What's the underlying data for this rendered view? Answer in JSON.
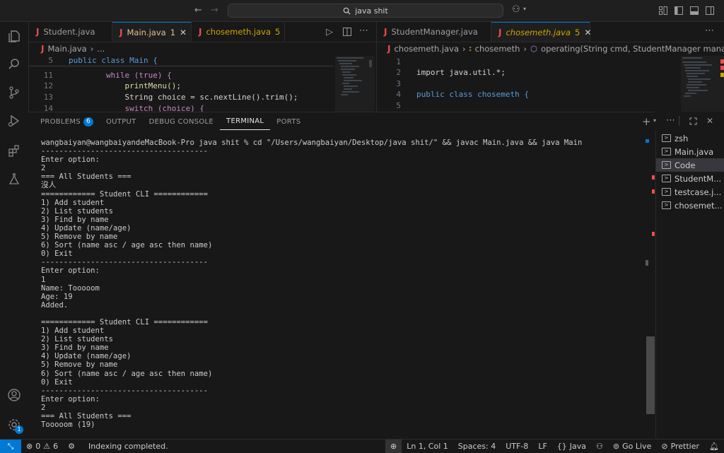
{
  "titlebar": {
    "search_text": "java shit"
  },
  "activity": {
    "accounts_badge": "1"
  },
  "left_group": {
    "tabs": [
      {
        "label": "Student.java",
        "badge": ""
      },
      {
        "label": "Main.java",
        "badge": "1"
      },
      {
        "label": "chosemeth.java",
        "badge": "5"
      }
    ],
    "breadcrumb": [
      "Main.java",
      "..."
    ],
    "sticky": {
      "num": "5",
      "text": "public class Main {"
    },
    "lines": [
      {
        "num": "11",
        "text": "        while (true) {"
      },
      {
        "num": "12",
        "text": "            printMenu();"
      },
      {
        "num": "13",
        "text": "            String choice = sc.nextLine().trim();"
      },
      {
        "num": "14",
        "text": "            switch (choice) {"
      }
    ]
  },
  "right_group": {
    "tabs": [
      {
        "label": "StudentManager.java",
        "badge": ""
      },
      {
        "label": "chosemeth.java",
        "badge": "5"
      }
    ],
    "breadcrumb": [
      "chosemeth.java",
      "chosemeth",
      "operating(String cmd, StudentManager manager)"
    ],
    "lines": [
      {
        "num": "1",
        "text": ""
      },
      {
        "num": "2",
        "text": "import java.util.*;"
      },
      {
        "num": "3",
        "text": ""
      },
      {
        "num": "4",
        "text": "public class chosemeth {"
      },
      {
        "num": "5",
        "text": ""
      }
    ]
  },
  "panel": {
    "tabs": [
      "PROBLEMS",
      "OUTPUT",
      "DEBUG CONSOLE",
      "TERMINAL",
      "PORTS"
    ],
    "problems_count": "6",
    "active_tab": "TERMINAL"
  },
  "terminal": {
    "lines": [
      "wangbaiyan@wangbaiyandeMacBook-Pro java shit % cd \"/Users/wangbaiyan/Desktop/java shit/\" && javac Main.java && java Main",
      "-------------------------------------",
      "Enter option:",
      "2",
      "=== All Students ===",
      "沒人",
      "============ Student CLI ============",
      "1) Add student",
      "2) List students",
      "3) Find by name",
      "4) Update (name/age)",
      "5) Remove by name",
      "6) Sort (name asc / age asc then name)",
      "0) Exit",
      "-------------------------------------",
      "Enter option:",
      "1",
      "Name: Tooooom",
      "Age: 19",
      "Added.",
      "",
      "============ Student CLI ============",
      "1) Add student",
      "2) List students",
      "3) Find by name",
      "4) Update (name/age)",
      "5) Remove by name",
      "6) Sort (name asc / age asc then name)",
      "0) Exit",
      "-------------------------------------",
      "Enter option:",
      "2",
      "=== All Students ===",
      "Tooooom (19)"
    ],
    "sessions": [
      {
        "label": "zsh",
        "selected": false
      },
      {
        "label": "Main.java",
        "selected": false
      },
      {
        "label": "Code",
        "selected": true
      },
      {
        "label": "StudentM...",
        "selected": false
      },
      {
        "label": "testcase.j...",
        "selected": false
      },
      {
        "label": "chosemet...",
        "selected": false
      }
    ]
  },
  "statusbar": {
    "errors": "0",
    "warnings": "6",
    "message": "Indexing completed.",
    "position": "Ln 1, Col 1",
    "spaces": "Spaces: 4",
    "encoding": "UTF-8",
    "eol": "LF",
    "language": "Java",
    "golive": "Go Live",
    "prettier": "Prettier"
  }
}
